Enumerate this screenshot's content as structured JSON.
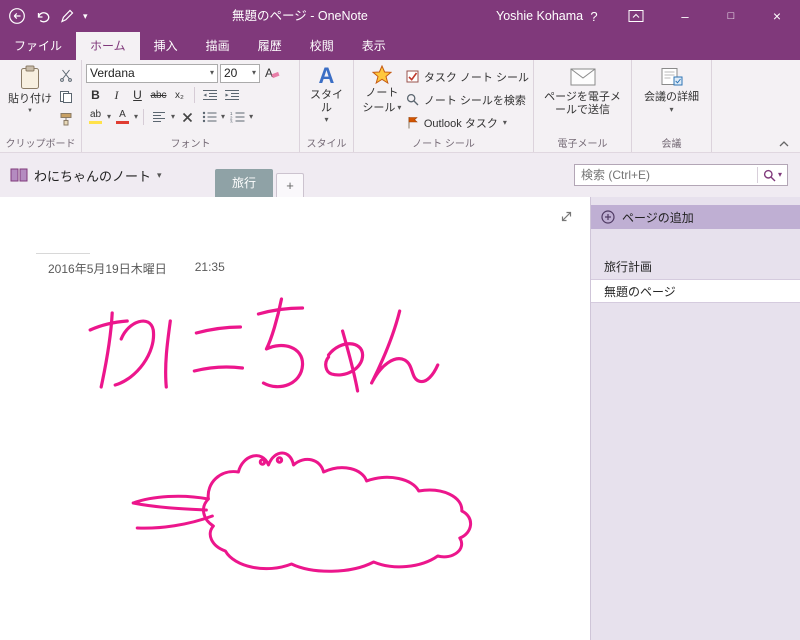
{
  "titlebar": {
    "title": "無題のページ - OneNote",
    "user": "Yoshie Kohama",
    "help": "?"
  },
  "tabs": {
    "file": "ファイル",
    "home": "ホーム",
    "insert": "挿入",
    "draw": "描画",
    "history": "履歴",
    "review": "校閲",
    "view": "表示"
  },
  "ribbon": {
    "clipboard": {
      "paste": "貼り付け",
      "group": "クリップボード"
    },
    "font": {
      "family": "Verdana",
      "size": "20",
      "bold": "B",
      "italic": "I",
      "underline": "U",
      "strike": "abc",
      "sub": "x₂",
      "highlight": "ab",
      "fontcolor": "A",
      "group": "フォント"
    },
    "style": {
      "icon_letter": "A",
      "button": "スタイル",
      "group": "スタイル"
    },
    "tags": {
      "line1": "ノート",
      "line2": "シール",
      "task": "タスク ノート シール",
      "find": "ノート シールを検索",
      "outlook": "Outlook タスク",
      "group": "ノート シール"
    },
    "email": {
      "button": "ページを電子メールで送信",
      "group": "電子メール"
    },
    "meeting": {
      "button": "会議の詳細",
      "group": "会議"
    }
  },
  "navbar": {
    "notebook": "わにちゃんのノート",
    "section": "旅行",
    "add_section": "+",
    "search_placeholder": "検索 (Ctrl+E)"
  },
  "page": {
    "date": "2016年5月19日木曜日",
    "time": "21:35"
  },
  "sidebar": {
    "add_page": "ページの追加",
    "pages": [
      {
        "label": "旅行計画"
      },
      {
        "label": "無題のページ"
      }
    ]
  },
  "icons": {
    "caret": "▾",
    "caret_solid": "▼",
    "minimize": "–",
    "maximize": "□",
    "close": "×"
  },
  "colors": {
    "titlebar": "#80397B",
    "accent": "#80397B",
    "ink": "#EC168C",
    "section_tab": "#8FA2A6",
    "sidebar": "#E7E1ED"
  }
}
